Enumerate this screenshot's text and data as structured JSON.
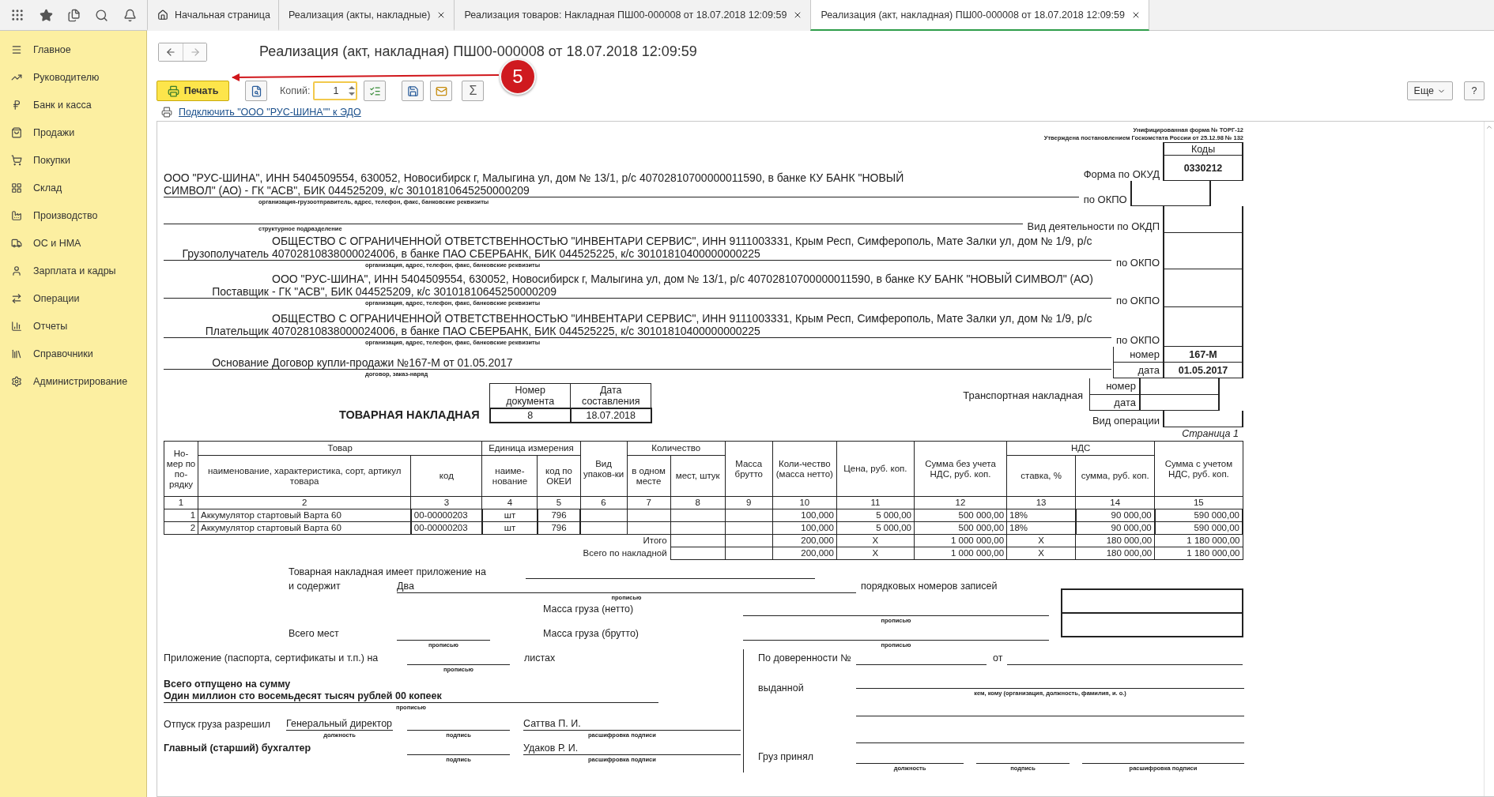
{
  "top_bar": {
    "tabs": [
      {
        "kind": "home",
        "label": "Начальная страница",
        "selected": false
      },
      {
        "kind": "document",
        "label": "Реализация (акты, накладные)",
        "selected": false
      },
      {
        "kind": "document",
        "label": "Реализация товаров: Накладная ПШ00-000008 от 18.07.2018 12:09:59",
        "selected": false
      },
      {
        "kind": "document",
        "label": "Реализация (акт, накладная) ПШ00-000008 от 18.07.2018 12:09:59",
        "selected": true
      }
    ]
  },
  "sidebar": {
    "items": [
      "Главное",
      "Руководителю",
      "Банк и касса",
      "Продажи",
      "Покупки",
      "Склад",
      "Производство",
      "ОС и НМА",
      "Зарплата и кадры",
      "Операции",
      "Отчеты",
      "Справочники",
      "Администрирование"
    ]
  },
  "title": "Реализация (акт, накладная) ПШ00-000008 от 18.07.2018 12:09:59",
  "toolbar": {
    "print": "Печать",
    "copies_label": "Копий:",
    "copies": "1",
    "sum": "Σ",
    "more": "Еще",
    "help": "?"
  },
  "edo_link": "Подключить \"ООО \"РУС-ШИНА\"\" к ЭДО",
  "document": {
    "form_name": "Унифицированная форма № ТОРГ-12",
    "approved": "Утверждена постановлением Госкомстата России от 25.12.98 № 132",
    "codes_title": "Коды",
    "parties": [
      {
        "text": "ООО \"РУС-ШИНА\", ИНН 5404509554, 630052, Новосибирск г, Малыгина ул, дом № 13/1, р/с 40702810700000011590, в банке КУ БАНК \"НОВЫЙ СИМВОЛ\" (АО) - ГК \"АСВ\", БИК 044525209, к/с 30101810645250000209",
        "caption": "организация-грузоотправитель, адрес, телефон, факс, банковские реквизиты",
        "codes": [
          {
            "kind": "plain",
            "label": "Форма по ОКУД",
            "value": "0330212"
          },
          {
            "kind": "plain",
            "label": "по ОКПО"
          }
        ]
      },
      {
        "caption": "структурное подразделение",
        "codes": [
          {
            "kind": "plain",
            "label": "Вид деятельности по ОКДП"
          }
        ]
      },
      {
        "label": "Грузополучатель",
        "text": "ОБЩЕСТВО С ОГРАНИЧЕННОЙ ОТВЕТСТВЕННОСТЬЮ \"ИНВЕНТАРИ СЕРВИС\", ИНН 9111003331, Крым Респ, Симферополь, Мате Залки ул, дом № 1/9, р/с 40702810838000024006, в банке ПАО СБЕРБАНК, БИК 044525225, к/с 30101810400000000225",
        "caption": "организация, адрес, телефон, факс, банковские реквизиты",
        "codes": [
          {
            "kind": "plain",
            "label": "по ОКПО"
          }
        ]
      },
      {
        "label": "Поставщик",
        "text": "ООО \"РУС-ШИНА\", ИНН 5404509554, 630052, Новосибирск г, Малыгина ул, дом № 13/1, р/с 40702810700000011590, в банке КУ БАНК \"НОВЫЙ СИМВОЛ\" (АО) - ГК \"АСВ\", БИК 044525209, к/с 30101810645250000209",
        "caption": "организация, адрес, телефон, факс, банковские реквизиты",
        "codes": [
          {
            "kind": "plain",
            "label": "по ОКПО"
          }
        ]
      },
      {
        "label": "Плательщик",
        "text": "ОБЩЕСТВО С ОГРАНИЧЕННОЙ ОТВЕТСТВЕННОСТЬЮ \"ИНВЕНТАРИ СЕРВИС\", ИНН 9111003331, Крым Респ, Симферополь, Мате Залки ул, дом № 1/9, р/с 40702810838000024006, в банке ПАО СБЕРБАНК, БИК 044525225, к/с 30101810400000000225",
        "caption": "организация, адрес, телефон, факс, банковские реквизиты",
        "codes": [
          {
            "kind": "plain",
            "label": "по ОКПО"
          }
        ]
      },
      {
        "label": "Основание",
        "text": "Договор купли-продажи №167-М от 01.05.2017",
        "caption": "договор, заказ-наряд",
        "codes": [
          {
            "kind": "boxed",
            "label": "номер",
            "value": "167-М"
          },
          {
            "kind": "boxed",
            "label": "дата",
            "value": "01.05.2017"
          }
        ]
      }
    ],
    "transport": {
      "title": "ТОВАРНАЯ НАКЛАДНАЯ",
      "doc_columns": [
        "Номер документа",
        "Дата составления"
      ],
      "doc_values": [
        "8",
        "18.07.2018"
      ],
      "label": "Транспортная накладная",
      "codes": [
        {
          "kind": "boxed",
          "label": "номер"
        },
        {
          "kind": "boxed",
          "label": "дата"
        },
        {
          "kind": "plain",
          "label": "Вид операции"
        }
      ]
    },
    "page_label": "Страница 1",
    "table": {
      "header_rows": [
        [
          {
            "text": "Но-мер по по-рядку",
            "rowspan": 2
          },
          {
            "text": "Товар",
            "colspan": 2
          },
          {
            "text": "Единица измерения",
            "colspan": 2
          },
          {
            "text": "Вид упаков-ки",
            "rowspan": 2
          },
          {
            "text": "Количество",
            "colspan": 2
          },
          {
            "text": "Масса брутто",
            "rowspan": 2
          },
          {
            "text": "Коли-чество (масса нетто)",
            "rowspan": 2
          },
          {
            "text": "Цена, руб. коп.",
            "rowspan": 2
          },
          {
            "text": "Сумма без учета НДС, руб. коп.",
            "rowspan": 2
          },
          {
            "text": "НДС",
            "colspan": 2
          },
          {
            "text": "Сумма с учетом НДС, руб. коп.",
            "rowspan": 2
          }
        ],
        [
          {
            "text": "наименование, характеристика, сорт, артикул товара"
          },
          {
            "text": "код"
          },
          {
            "text": "наиме-нование"
          },
          {
            "text": "код по ОКЕИ"
          },
          {
            "text": "в одном месте"
          },
          {
            "text": "мест, штук"
          },
          {
            "text": "ставка, %"
          },
          {
            "text": "сумма, руб. коп."
          }
        ]
      ],
      "numbers": [
        "1",
        "2",
        "3",
        "4",
        "5",
        "6",
        "7",
        "8",
        "9",
        "10",
        "11",
        "12",
        "13",
        "14",
        "15"
      ],
      "rows": [
        [
          "1",
          "Аккумулятор стартовый Варта 60",
          "00-00000203",
          "шт",
          "796",
          null,
          null,
          null,
          null,
          "100,000",
          "5 000,00",
          "500 000,00",
          "18%",
          "90 000,00",
          "590 000,00"
        ],
        [
          "2",
          "Аккумулятор стартовый Варта 60",
          "00-00000203",
          "шт",
          "796",
          null,
          null,
          null,
          null,
          "100,000",
          "5 000,00",
          "500 000,00",
          "18%",
          "90 000,00",
          "590 000,00"
        ]
      ],
      "totals": [
        {
          "label": "Итого",
          "cells": [
            null,
            null,
            "200,000",
            "X",
            "1 000 000,00",
            "X",
            "180 000,00",
            "1 180 000,00"
          ]
        },
        {
          "label": "Всего по накладной",
          "cells": [
            null,
            null,
            "200,000",
            "X",
            "1 000 000,00",
            "X",
            "180 000,00",
            "1 180 000,00"
          ]
        }
      ]
    },
    "appendix": {
      "has_label": "Товарная накладная имеет приложение на",
      "contains_label": "и содержит",
      "contains_value": "Два",
      "contains_caption": "прописью",
      "records_label": "порядковых номеров записей",
      "net_label": "Масса груза (нетто)",
      "net_caption": "прописью",
      "places_label": "Всего мест",
      "places_caption": "прописью",
      "gross_label": "Масса груза (брутто)",
      "gross_caption": "прописью"
    },
    "release": {
      "attachment_label": "Приложение (паспорта, сертификаты и т.п.) на",
      "attachment_caption": "прописью",
      "sheets_label": "листах",
      "total_label": "Всего отпущено  на сумму",
      "total_words": "Один миллион сто восемьдесят тысяч рублей 00 копеек",
      "total_caption": "прописью",
      "allowed_label": "Отпуск груза разрешил",
      "position": "Генеральный директор",
      "position_caption": "должность",
      "signature_caption": "подпись",
      "name": "Саттва П. И.",
      "name_caption": "расшифровка подписи",
      "accountant_label": "Главный (старший) бухгалтер",
      "accountant_signature_caption": "подпись",
      "accountant_name": "Удаков Р. И.",
      "accountant_name_caption": "расшифровка подписи"
    },
    "receipt": {
      "proxy_label": "По доверенности №",
      "from_label": "от",
      "issued_label": "выданной",
      "issued_caption": "кем, кому (организация, должность, фамилия, и. о.)",
      "received_label": "Груз принял",
      "captions": [
        "должность",
        "подпись",
        "расшифровка подписи"
      ]
    }
  },
  "callout": {
    "number": "5"
  }
}
